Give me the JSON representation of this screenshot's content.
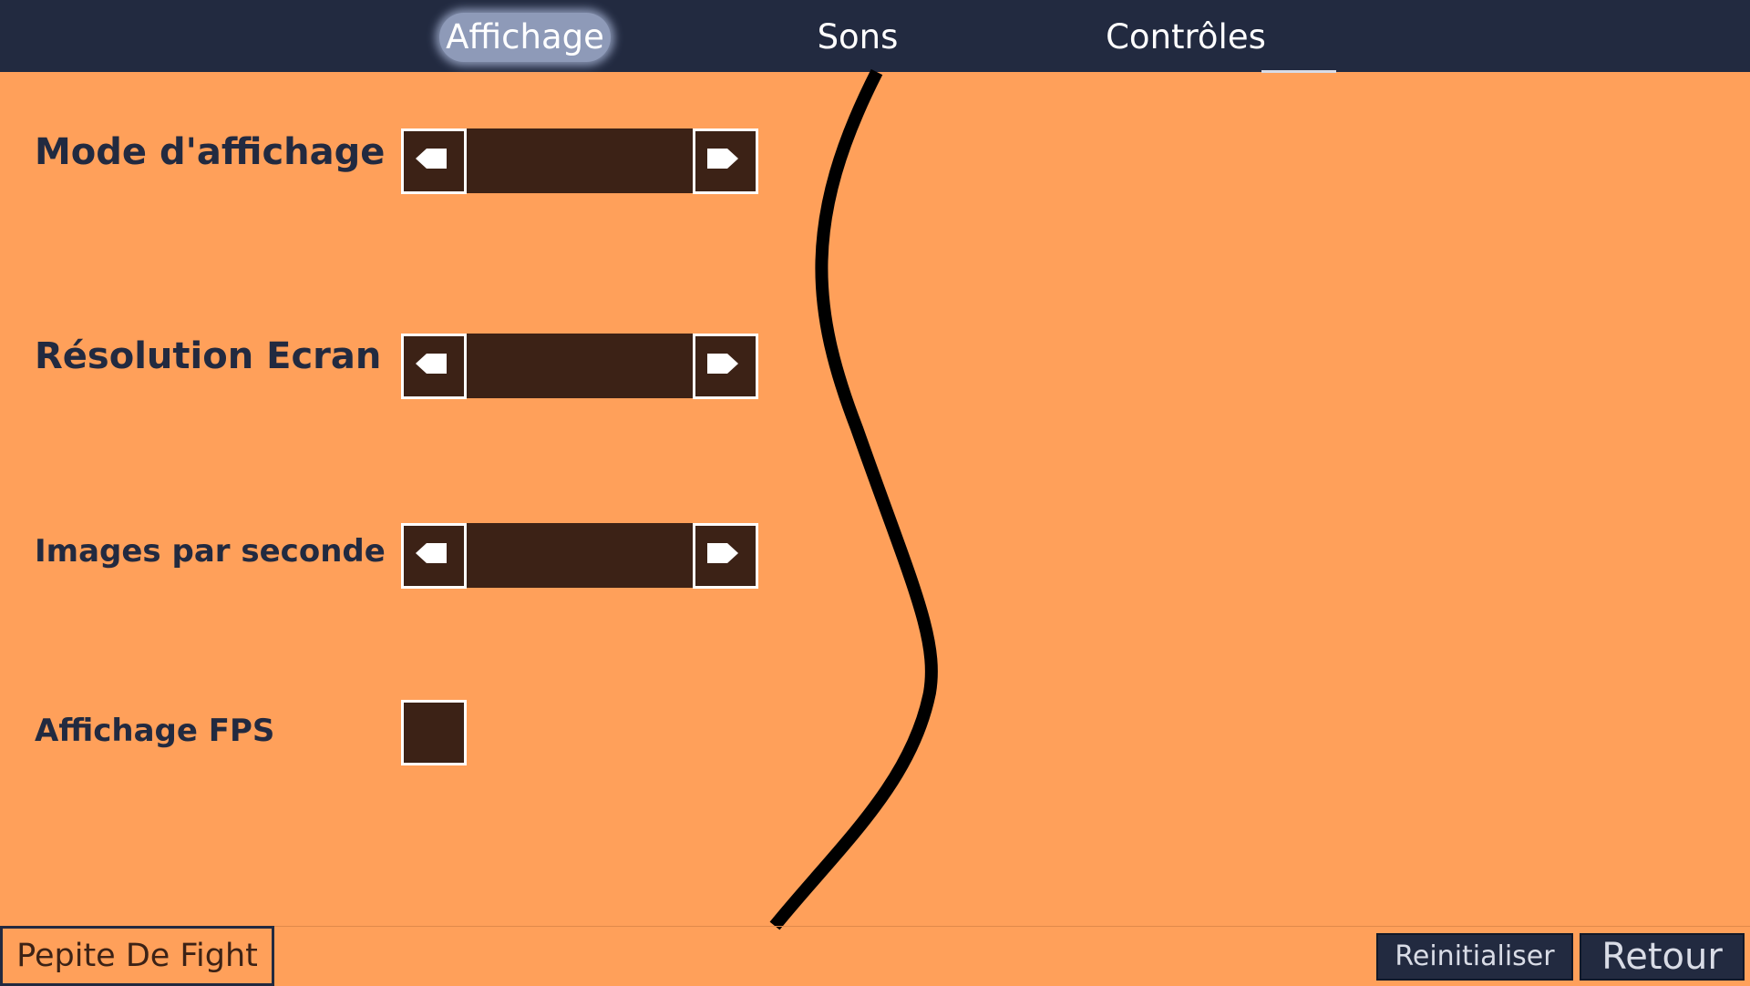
{
  "tabs": [
    {
      "label": "Affichage",
      "active": true
    },
    {
      "label": "Sons",
      "active": false
    },
    {
      "label": "Contrôles",
      "active": false
    }
  ],
  "options": {
    "display_mode": {
      "label": "Mode d'affichage",
      "value": ""
    },
    "screen_resolution": {
      "label": "Résolution Ecran",
      "value": ""
    },
    "frame_rate": {
      "label": "Images par seconde",
      "value": ""
    },
    "fps_display": {
      "label": "Affichage FPS",
      "checked": false
    }
  },
  "footer": {
    "brand": "Pepite De Fight",
    "reset_label": "Reinitialiser",
    "back_label": "Retour"
  },
  "colors": {
    "background": "#ffa05a",
    "bar": "#222a40",
    "control": "#3c2216",
    "active_tab": "#8e9ab8"
  }
}
